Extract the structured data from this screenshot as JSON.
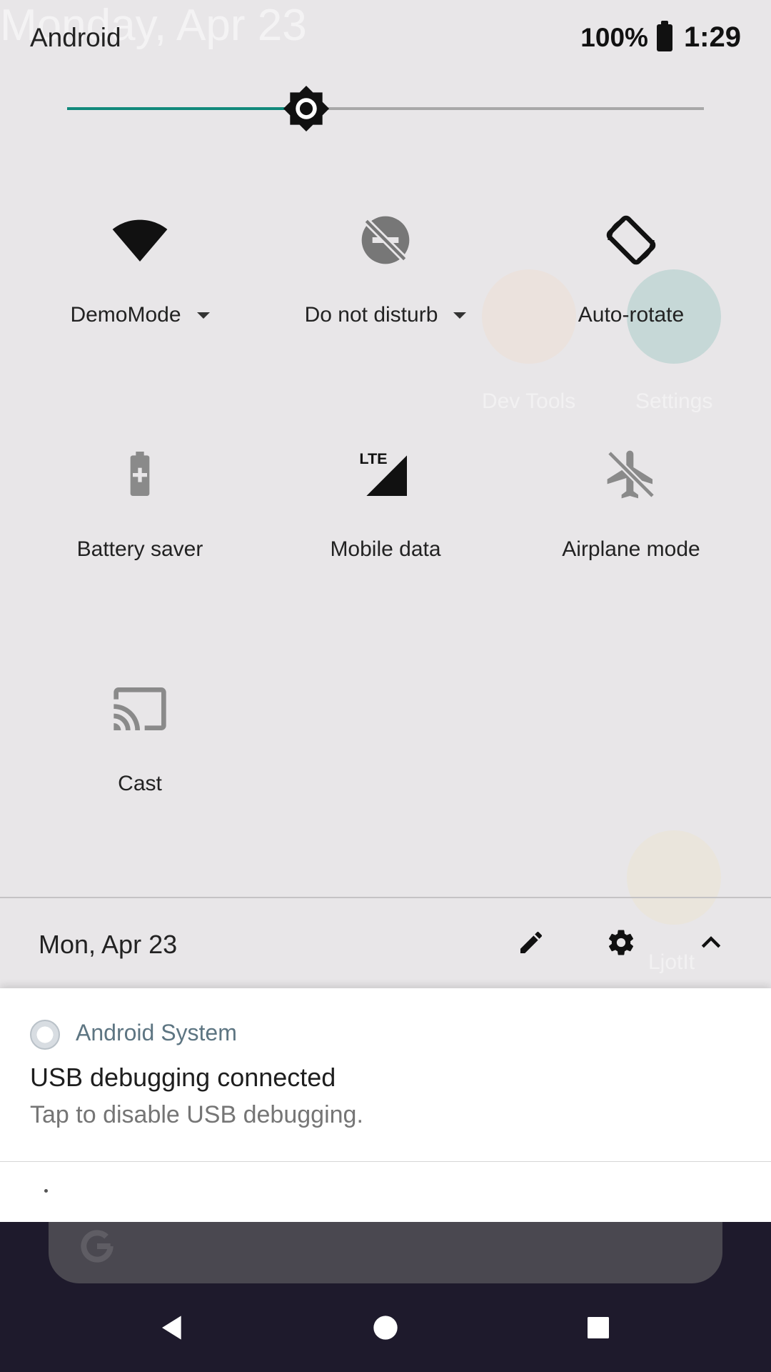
{
  "status_bar": {
    "carrier": "Android",
    "battery_percent": "100%",
    "time": "1:29"
  },
  "brightness": {
    "level_fraction": 0.375
  },
  "background_home": {
    "date": "Monday, Apr 23",
    "apps": [
      "Dev Tools",
      "Settings",
      "LjotIt"
    ]
  },
  "tiles": [
    {
      "label": "DemoMode",
      "icon": "wifi-icon",
      "has_dropdown": true
    },
    {
      "label": "Do not disturb",
      "icon": "do-not-disturb-icon",
      "has_dropdown": true
    },
    {
      "label": "Auto-rotate",
      "icon": "auto-rotate-icon",
      "has_dropdown": false
    },
    {
      "label": "Battery saver",
      "icon": "battery-saver-icon",
      "has_dropdown": false
    },
    {
      "label": "Mobile data",
      "icon": "mobile-data-lte-icon",
      "badge": "LTE",
      "has_dropdown": false
    },
    {
      "label": "Airplane mode",
      "icon": "airplane-mode-off-icon",
      "has_dropdown": false
    },
    {
      "label": "Cast",
      "icon": "cast-icon",
      "has_dropdown": false
    }
  ],
  "footer": {
    "date": "Mon, Apr 23",
    "buttons": [
      "edit-icon",
      "settings-icon",
      "collapse-icon"
    ]
  },
  "notification": {
    "app_name": "Android System",
    "title": "USB debugging connected",
    "text": "Tap to disable USB debugging."
  },
  "colors": {
    "accent": "#11897b",
    "panel_bg": "#e8e6e8",
    "nav_bg": "#1e1a2c",
    "notif_app_color": "#5d7582"
  }
}
